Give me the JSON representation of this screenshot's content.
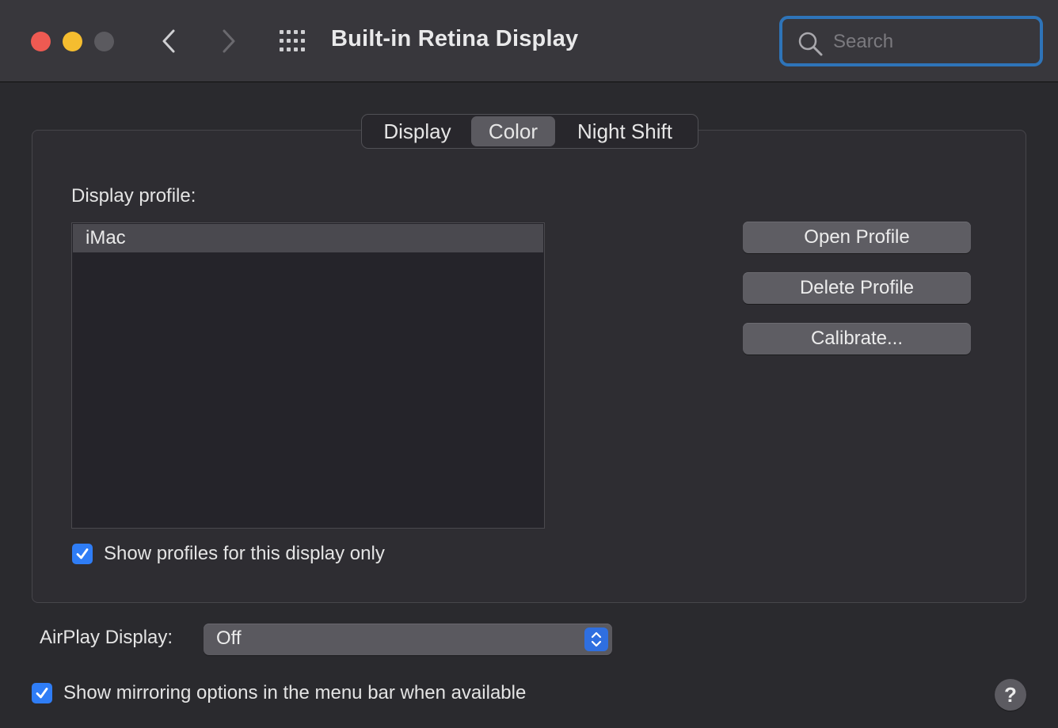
{
  "window": {
    "title": "Built-in Retina Display",
    "search_placeholder": "Search"
  },
  "toolbar": {
    "back_icon": "chevron-left-icon",
    "forward_icon": "chevron-right-icon",
    "grid_icon": "show-all-grid-icon"
  },
  "tabs": [
    {
      "label": "Display",
      "selected": false
    },
    {
      "label": "Color",
      "selected": true
    },
    {
      "label": "Night Shift",
      "selected": false
    }
  ],
  "color_panel": {
    "profile_label": "Display profile:",
    "profiles": [
      "iMac"
    ],
    "selected_profile": "iMac",
    "buttons": {
      "open": "Open Profile",
      "delete": "Delete Profile",
      "calibrate": "Calibrate..."
    },
    "show_profiles_checkbox": {
      "label": "Show profiles for this display only",
      "checked": true
    }
  },
  "airplay": {
    "label": "AirPlay Display:",
    "value": "Off"
  },
  "mirroring_checkbox": {
    "label": "Show mirroring options in the menu bar when available",
    "checked": true
  },
  "help_label": "?",
  "colors": {
    "accent": "#2f7df6",
    "close": "#ee5a52",
    "minimize": "#f5bd2f",
    "zoom_disabled": "#5b5a5f",
    "search_focus": "#2e74b9"
  }
}
